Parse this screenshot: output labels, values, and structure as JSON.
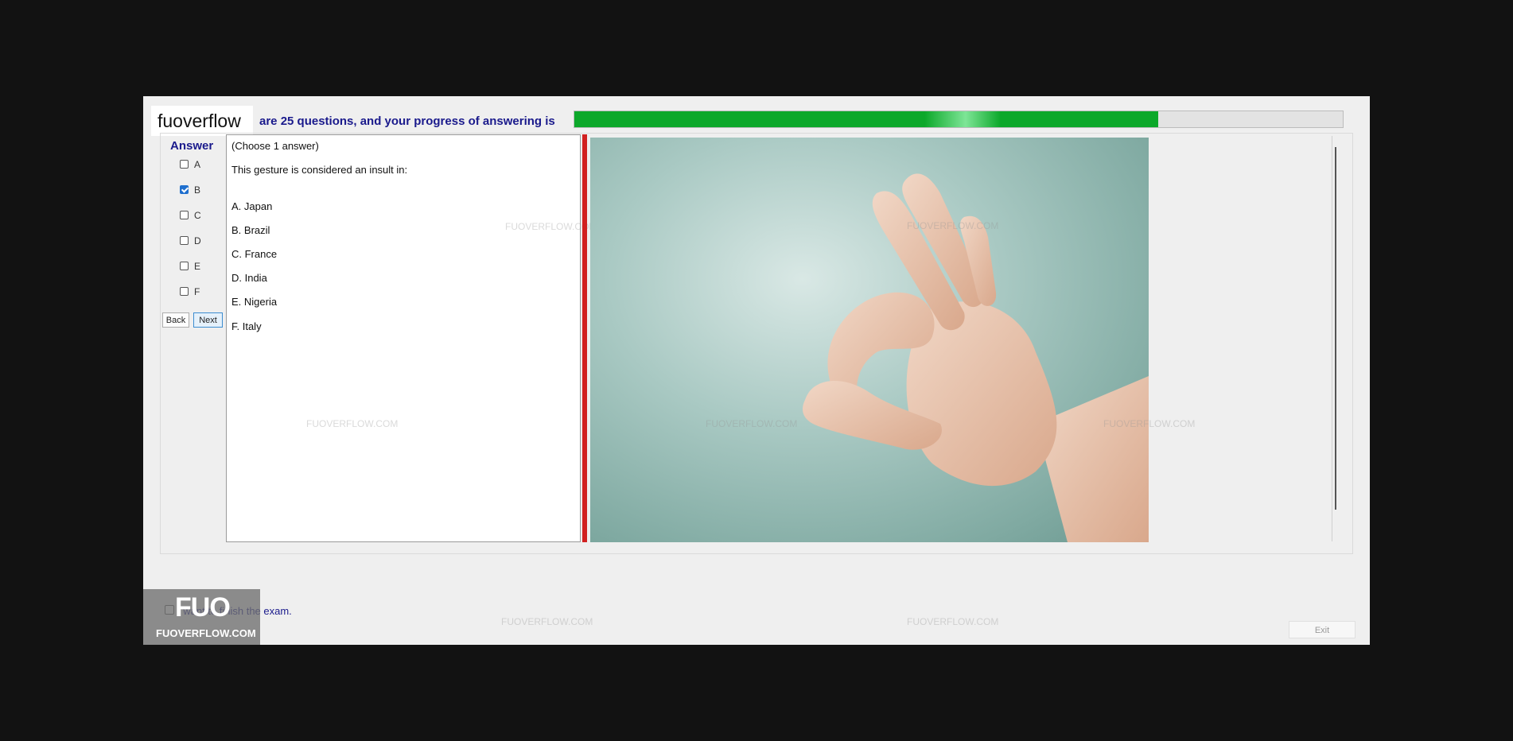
{
  "brand": {
    "name": "fuoverflow"
  },
  "progress": {
    "text": "are 25 questions, and your progress of answering is",
    "value_fraction": 0.76
  },
  "answer_panel": {
    "title": "Answer",
    "options": [
      {
        "label": "A",
        "checked": false
      },
      {
        "label": "B",
        "checked": true
      },
      {
        "label": "C",
        "checked": false
      },
      {
        "label": "D",
        "checked": false
      },
      {
        "label": "E",
        "checked": false
      },
      {
        "label": "F",
        "checked": false
      }
    ],
    "back_label": "Back",
    "next_label": "Next"
  },
  "question": {
    "instruction": "(Choose 1 answer)",
    "prompt": "This gesture is considered an insult in:",
    "choices": [
      "A.  Japan",
      "B.  Brazil",
      "C.  France",
      "D.  India",
      "E.  Nigeria",
      "F.  Italy"
    ]
  },
  "footer": {
    "finish_label": "I want to finish the exam.",
    "exit_label": "Exit"
  },
  "logo": {
    "big": "FUO",
    "small": "FUOVERFLOW.COM"
  },
  "watermark": {
    "text": "FUOVERFLOW.COM"
  },
  "image": {
    "icon": "ok-hand-gesture-icon"
  },
  "colors": {
    "progress": "#0ca82a",
    "accent_text": "#1a1a8c",
    "divider": "#d12020"
  }
}
